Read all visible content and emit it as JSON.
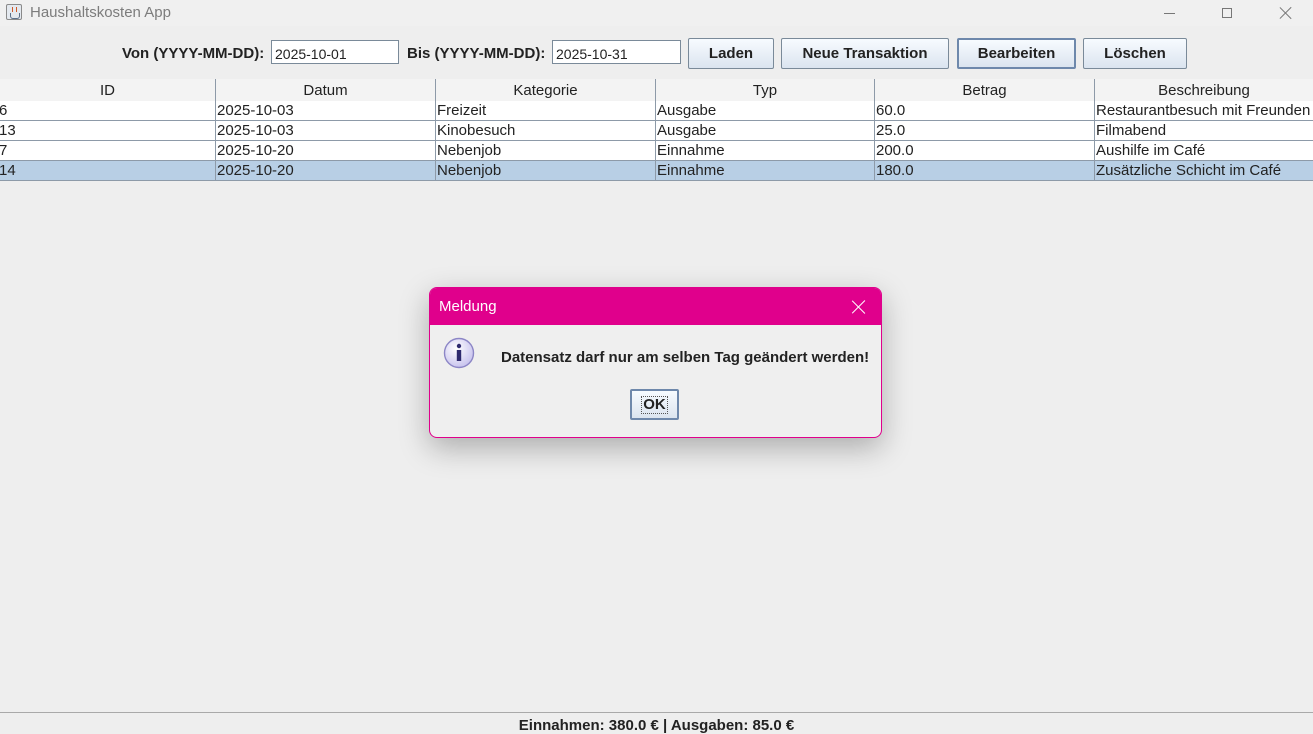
{
  "window": {
    "title": "Haushaltskosten App"
  },
  "toolbar": {
    "from_label": "Von (YYYY-MM-DD):",
    "from_value": "2025-10-01",
    "to_label": "Bis (YYYY-MM-DD):",
    "to_value": "2025-10-31",
    "load_label": "Laden",
    "new_label": "Neue Transaktion",
    "edit_label": "Bearbeiten",
    "delete_label": "Löschen"
  },
  "table": {
    "columns": [
      "ID",
      "Datum",
      "Kategorie",
      "Typ",
      "Betrag",
      "Beschreibung"
    ],
    "rows": [
      [
        "6",
        "2025-10-03",
        "Freizeit",
        "Ausgabe",
        "60.0",
        "Restaurantbesuch mit Freunden"
      ],
      [
        "13",
        "2025-10-03",
        "Kinobesuch",
        "Ausgabe",
        "25.0",
        "Filmabend"
      ],
      [
        "7",
        "2025-10-20",
        "Nebenjob",
        "Einnahme",
        "200.0",
        "Aushilfe im Café"
      ],
      [
        "14",
        "2025-10-20",
        "Nebenjob",
        "Einnahme",
        "180.0",
        "Zusätzliche Schicht im Café"
      ]
    ],
    "selected_row_id": "14"
  },
  "status": {
    "summary": "Einnahmen: 380.0 € | Ausgaben: 85.0 €"
  },
  "dialog": {
    "title": "Meldung",
    "message": "Datensatz darf nur am selben Tag geändert werden!",
    "ok_label": "OK",
    "icon": "info-icon"
  },
  "colors": {
    "dialog_accent": "#e0008c",
    "selected_row": "#b8cfe5"
  }
}
